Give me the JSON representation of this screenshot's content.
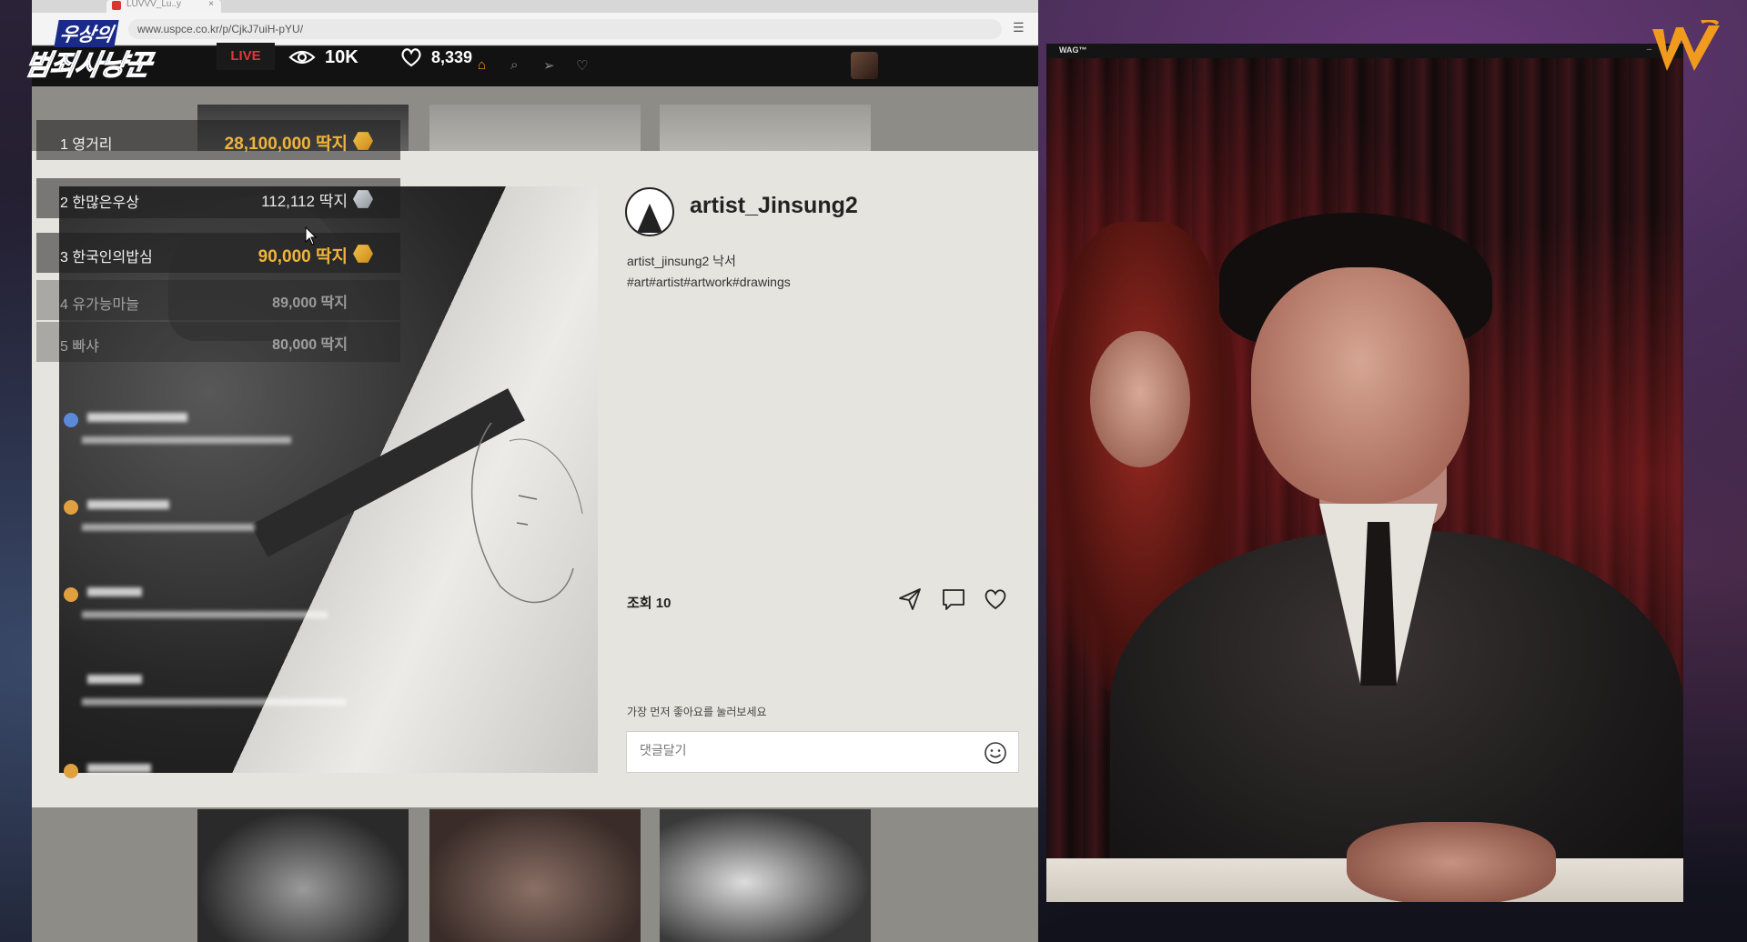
{
  "browser": {
    "tab_title": "LUVVV_Lu..y",
    "tab_close": "×",
    "url": "www.uspce.co.kr/p/CjkJ7uiH-pYU/"
  },
  "overlay": {
    "show_title_line1": "우상의",
    "show_title_line2": "범죄사냥꾼",
    "live_label": "LIVE",
    "view_count": "10K",
    "like_count": "8,339"
  },
  "post": {
    "username": "artist_Jinsung2",
    "caption": "artist_jinsung2 낙서",
    "hashtags": "#art#artist#artwork#drawings",
    "views_label": "조회 10",
    "like_prompt": "가장 먼저 좋아요를 눌러보세요",
    "comment_placeholder": "댓글달기"
  },
  "leaderboard": [
    {
      "rank_name": "1 영거리",
      "amount": "28,100,000 딱지",
      "coin": "gold"
    },
    {
      "rank_name": "2 한많은우상",
      "amount": "112,112 딱지",
      "coin": "silver"
    },
    {
      "rank_name": "3 한국인의밥심",
      "amount": "90,000 딱지",
      "coin": "gold"
    },
    {
      "rank_name": "4 유가능마늘",
      "amount": "89,000 딱지",
      "coin": "none"
    },
    {
      "rank_name": "5 빠샤",
      "amount": "80,000 딱지",
      "coin": "none"
    }
  ],
  "video_window": {
    "title": "WAG™",
    "controls": "– □"
  },
  "colors": {
    "accent_gold": "#f0b43a",
    "live_red": "#e4343d",
    "logo_orange": "#f09a1e"
  }
}
